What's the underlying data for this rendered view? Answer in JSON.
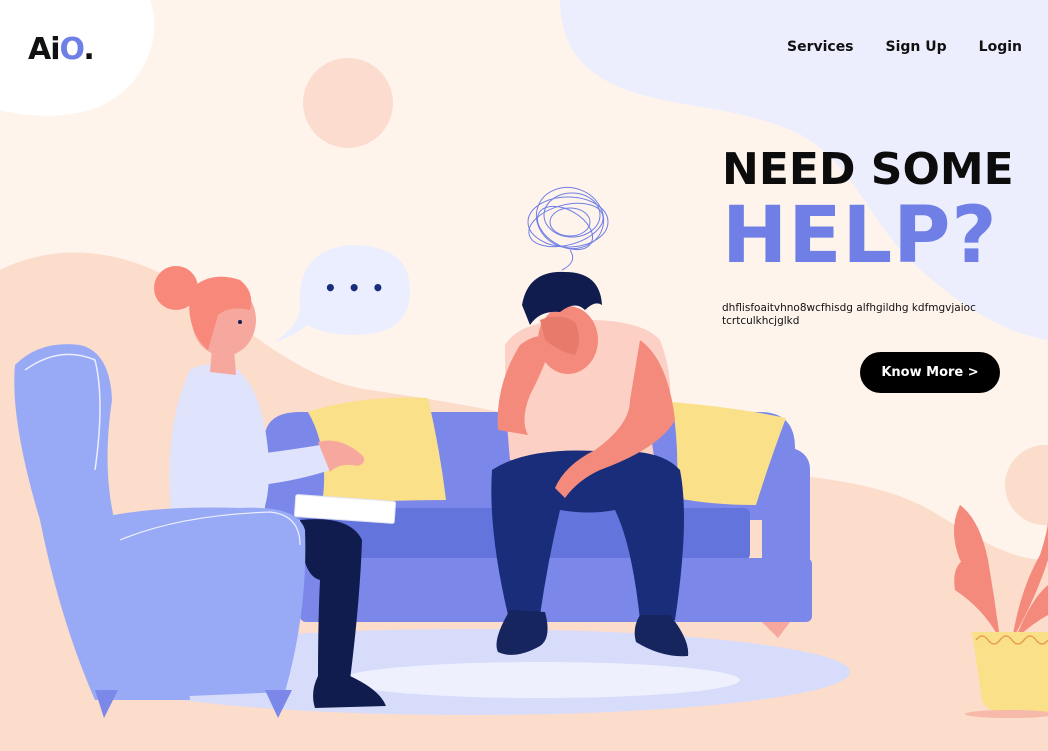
{
  "brand": {
    "prefix": "Ai",
    "o": "O",
    "dot": "."
  },
  "nav": {
    "services": "Services",
    "signup": "Sign Up",
    "login": "Login"
  },
  "hero": {
    "line1": "NEED SOME",
    "line2": "HELP?",
    "description": "dhflisfoaitvhno8wcfhisdg alfhgildhg kdfmgvjaioc tcrtculkhcjglkd",
    "cta": "Know More >"
  },
  "bubble": {
    "dots": "• • •"
  },
  "colors": {
    "accent": "#6f7fe6",
    "background": "#fef4ec",
    "button": "#000000"
  }
}
